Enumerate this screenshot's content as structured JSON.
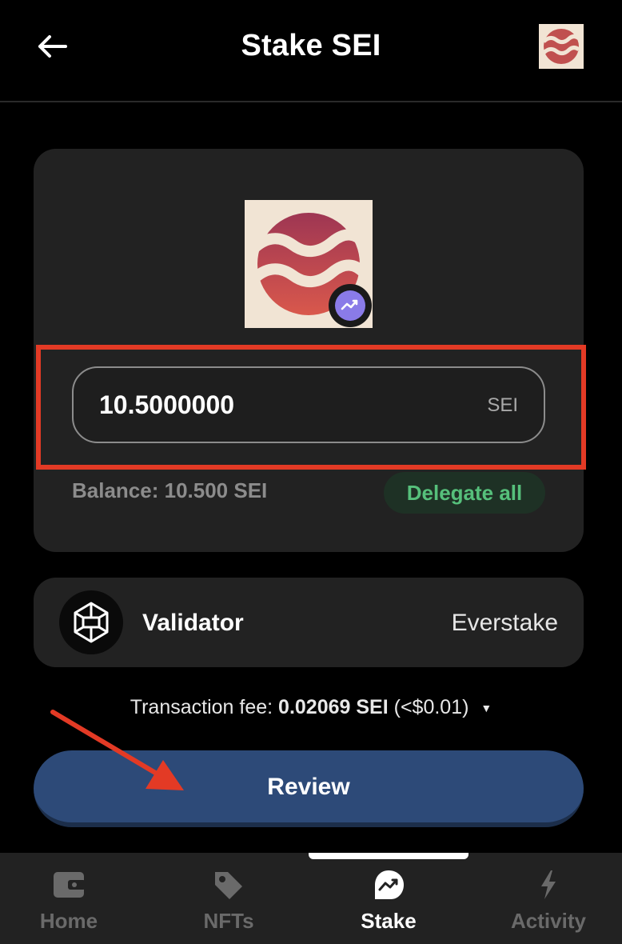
{
  "header": {
    "title": "Stake SEI",
    "back_icon": "arrow-left-icon",
    "logo_icon": "sei-logo-icon"
  },
  "stake": {
    "amount": "10.5000000",
    "unit": "SEI",
    "balance": "Balance: 10.500 SEI",
    "delegate_all": "Delegate all"
  },
  "validator": {
    "label": "Validator",
    "name": "Everstake",
    "icon": "everstake-icon"
  },
  "fee": {
    "label": "Transaction fee:",
    "value": "0.02069 SEI",
    "usd": "(<$0.01)"
  },
  "review_label": "Review",
  "tabs": [
    {
      "label": "Home",
      "icon": "wallet-icon",
      "active": false
    },
    {
      "label": "NFTs",
      "icon": "tag-icon",
      "active": false
    },
    {
      "label": "Stake",
      "icon": "stake-icon",
      "active": true
    },
    {
      "label": "Activity",
      "icon": "bolt-icon",
      "active": false
    }
  ],
  "colors": {
    "accent_blue": "#2d4a78",
    "highlight_red": "#e33a25",
    "green": "#56c07b",
    "card": "#222222"
  }
}
